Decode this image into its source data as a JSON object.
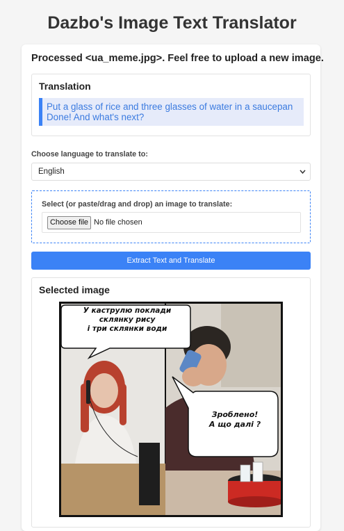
{
  "app": {
    "title": "Dazbo's Image Text Translator",
    "status": "Processed <ua_meme.jpg>. Feel free to upload a new image."
  },
  "translation": {
    "heading": "Translation",
    "lines": [
      "Put a glass of rice and three glasses of water in a saucepan",
      "Done! And what's next?"
    ]
  },
  "language": {
    "label": "Choose language to translate to:",
    "selected": "English"
  },
  "upload": {
    "label": "Select (or paste/drag and drop) an image to translate:",
    "button_label": "Choose file",
    "file_status": "No file chosen"
  },
  "extract_button": "Extract Text and Translate",
  "selected_image": {
    "heading": "Selected image",
    "bubble1": [
      "У каструлю поклади",
      "склянку рису",
      "і три склянки води"
    ],
    "bubble2": [
      "Зроблено!",
      "А що далі ?"
    ]
  },
  "colors": {
    "accent": "#3b82f6",
    "translation_bg": "#e6ebfa",
    "translation_text": "#3b7be0"
  }
}
